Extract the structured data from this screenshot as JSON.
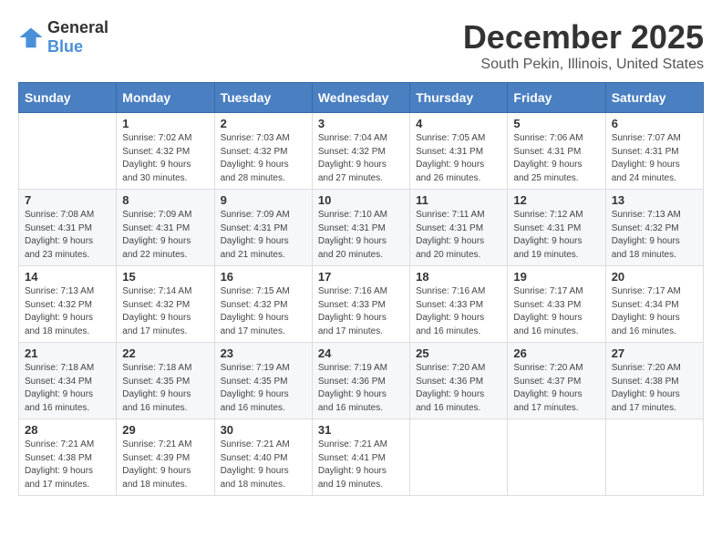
{
  "logo": {
    "general": "General",
    "blue": "Blue"
  },
  "header": {
    "month": "December 2025",
    "location": "South Pekin, Illinois, United States"
  },
  "days_of_week": [
    "Sunday",
    "Monday",
    "Tuesday",
    "Wednesday",
    "Thursday",
    "Friday",
    "Saturday"
  ],
  "weeks": [
    [
      {
        "day": "",
        "sunrise": "",
        "sunset": "",
        "daylight": ""
      },
      {
        "day": "1",
        "sunrise": "Sunrise: 7:02 AM",
        "sunset": "Sunset: 4:32 PM",
        "daylight": "Daylight: 9 hours and 30 minutes."
      },
      {
        "day": "2",
        "sunrise": "Sunrise: 7:03 AM",
        "sunset": "Sunset: 4:32 PM",
        "daylight": "Daylight: 9 hours and 28 minutes."
      },
      {
        "day": "3",
        "sunrise": "Sunrise: 7:04 AM",
        "sunset": "Sunset: 4:32 PM",
        "daylight": "Daylight: 9 hours and 27 minutes."
      },
      {
        "day": "4",
        "sunrise": "Sunrise: 7:05 AM",
        "sunset": "Sunset: 4:31 PM",
        "daylight": "Daylight: 9 hours and 26 minutes."
      },
      {
        "day": "5",
        "sunrise": "Sunrise: 7:06 AM",
        "sunset": "Sunset: 4:31 PM",
        "daylight": "Daylight: 9 hours and 25 minutes."
      },
      {
        "day": "6",
        "sunrise": "Sunrise: 7:07 AM",
        "sunset": "Sunset: 4:31 PM",
        "daylight": "Daylight: 9 hours and 24 minutes."
      }
    ],
    [
      {
        "day": "7",
        "sunrise": "Sunrise: 7:08 AM",
        "sunset": "Sunset: 4:31 PM",
        "daylight": "Daylight: 9 hours and 23 minutes."
      },
      {
        "day": "8",
        "sunrise": "Sunrise: 7:09 AM",
        "sunset": "Sunset: 4:31 PM",
        "daylight": "Daylight: 9 hours and 22 minutes."
      },
      {
        "day": "9",
        "sunrise": "Sunrise: 7:09 AM",
        "sunset": "Sunset: 4:31 PM",
        "daylight": "Daylight: 9 hours and 21 minutes."
      },
      {
        "day": "10",
        "sunrise": "Sunrise: 7:10 AM",
        "sunset": "Sunset: 4:31 PM",
        "daylight": "Daylight: 9 hours and 20 minutes."
      },
      {
        "day": "11",
        "sunrise": "Sunrise: 7:11 AM",
        "sunset": "Sunset: 4:31 PM",
        "daylight": "Daylight: 9 hours and 20 minutes."
      },
      {
        "day": "12",
        "sunrise": "Sunrise: 7:12 AM",
        "sunset": "Sunset: 4:31 PM",
        "daylight": "Daylight: 9 hours and 19 minutes."
      },
      {
        "day": "13",
        "sunrise": "Sunrise: 7:13 AM",
        "sunset": "Sunset: 4:32 PM",
        "daylight": "Daylight: 9 hours and 18 minutes."
      }
    ],
    [
      {
        "day": "14",
        "sunrise": "Sunrise: 7:13 AM",
        "sunset": "Sunset: 4:32 PM",
        "daylight": "Daylight: 9 hours and 18 minutes."
      },
      {
        "day": "15",
        "sunrise": "Sunrise: 7:14 AM",
        "sunset": "Sunset: 4:32 PM",
        "daylight": "Daylight: 9 hours and 17 minutes."
      },
      {
        "day": "16",
        "sunrise": "Sunrise: 7:15 AM",
        "sunset": "Sunset: 4:32 PM",
        "daylight": "Daylight: 9 hours and 17 minutes."
      },
      {
        "day": "17",
        "sunrise": "Sunrise: 7:16 AM",
        "sunset": "Sunset: 4:33 PM",
        "daylight": "Daylight: 9 hours and 17 minutes."
      },
      {
        "day": "18",
        "sunrise": "Sunrise: 7:16 AM",
        "sunset": "Sunset: 4:33 PM",
        "daylight": "Daylight: 9 hours and 16 minutes."
      },
      {
        "day": "19",
        "sunrise": "Sunrise: 7:17 AM",
        "sunset": "Sunset: 4:33 PM",
        "daylight": "Daylight: 9 hours and 16 minutes."
      },
      {
        "day": "20",
        "sunrise": "Sunrise: 7:17 AM",
        "sunset": "Sunset: 4:34 PM",
        "daylight": "Daylight: 9 hours and 16 minutes."
      }
    ],
    [
      {
        "day": "21",
        "sunrise": "Sunrise: 7:18 AM",
        "sunset": "Sunset: 4:34 PM",
        "daylight": "Daylight: 9 hours and 16 minutes."
      },
      {
        "day": "22",
        "sunrise": "Sunrise: 7:18 AM",
        "sunset": "Sunset: 4:35 PM",
        "daylight": "Daylight: 9 hours and 16 minutes."
      },
      {
        "day": "23",
        "sunrise": "Sunrise: 7:19 AM",
        "sunset": "Sunset: 4:35 PM",
        "daylight": "Daylight: 9 hours and 16 minutes."
      },
      {
        "day": "24",
        "sunrise": "Sunrise: 7:19 AM",
        "sunset": "Sunset: 4:36 PM",
        "daylight": "Daylight: 9 hours and 16 minutes."
      },
      {
        "day": "25",
        "sunrise": "Sunrise: 7:20 AM",
        "sunset": "Sunset: 4:36 PM",
        "daylight": "Daylight: 9 hours and 16 minutes."
      },
      {
        "day": "26",
        "sunrise": "Sunrise: 7:20 AM",
        "sunset": "Sunset: 4:37 PM",
        "daylight": "Daylight: 9 hours and 17 minutes."
      },
      {
        "day": "27",
        "sunrise": "Sunrise: 7:20 AM",
        "sunset": "Sunset: 4:38 PM",
        "daylight": "Daylight: 9 hours and 17 minutes."
      }
    ],
    [
      {
        "day": "28",
        "sunrise": "Sunrise: 7:21 AM",
        "sunset": "Sunset: 4:38 PM",
        "daylight": "Daylight: 9 hours and 17 minutes."
      },
      {
        "day": "29",
        "sunrise": "Sunrise: 7:21 AM",
        "sunset": "Sunset: 4:39 PM",
        "daylight": "Daylight: 9 hours and 18 minutes."
      },
      {
        "day": "30",
        "sunrise": "Sunrise: 7:21 AM",
        "sunset": "Sunset: 4:40 PM",
        "daylight": "Daylight: 9 hours and 18 minutes."
      },
      {
        "day": "31",
        "sunrise": "Sunrise: 7:21 AM",
        "sunset": "Sunset: 4:41 PM",
        "daylight": "Daylight: 9 hours and 19 minutes."
      },
      {
        "day": "",
        "sunrise": "",
        "sunset": "",
        "daylight": ""
      },
      {
        "day": "",
        "sunrise": "",
        "sunset": "",
        "daylight": ""
      },
      {
        "day": "",
        "sunrise": "",
        "sunset": "",
        "daylight": ""
      }
    ]
  ]
}
